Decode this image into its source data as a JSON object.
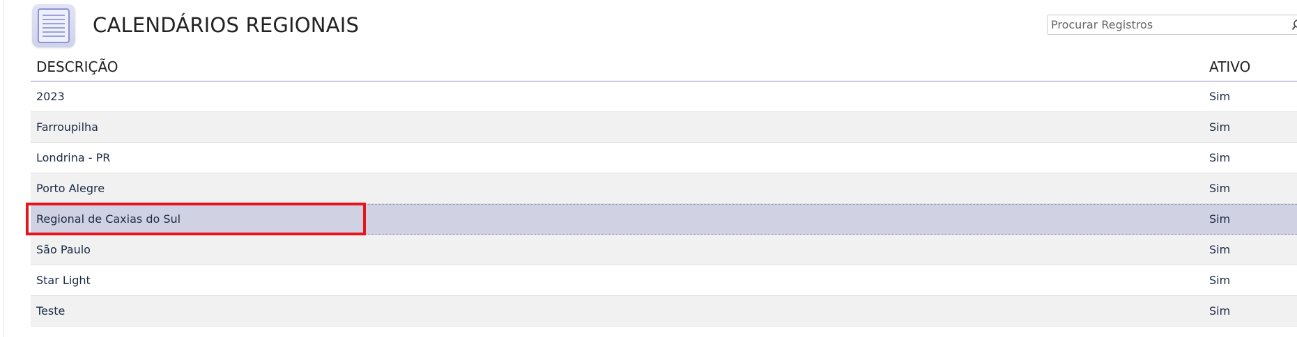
{
  "header": {
    "title": "CALENDÁRIOS REGIONAIS",
    "icon": "list-document-icon"
  },
  "search": {
    "placeholder": "Procurar Registros",
    "value": "",
    "icon": "search-icon"
  },
  "table": {
    "columns": [
      "DESCRIÇÃO",
      "ATIVO"
    ],
    "rows": [
      {
        "descricao": "2023",
        "ativo": "Sim"
      },
      {
        "descricao": "Farroupilha",
        "ativo": "Sim"
      },
      {
        "descricao": "Londrina - PR",
        "ativo": "Sim"
      },
      {
        "descricao": "Porto Alegre",
        "ativo": "Sim"
      },
      {
        "descricao": "Regional de Caxias do Sul",
        "ativo": "Sim"
      },
      {
        "descricao": "São Paulo",
        "ativo": "Sim"
      },
      {
        "descricao": "Star Light",
        "ativo": "Sim"
      },
      {
        "descricao": "Teste",
        "ativo": "Sim"
      }
    ],
    "selected_row": "Regional de Caxias do Sul"
  },
  "colors": {
    "selected_row_bg": "#d1d1e4",
    "highlight_border": "#e8141c",
    "header_rule": "#8c8cc4",
    "striped_row_bg": "#f1f1f1"
  }
}
